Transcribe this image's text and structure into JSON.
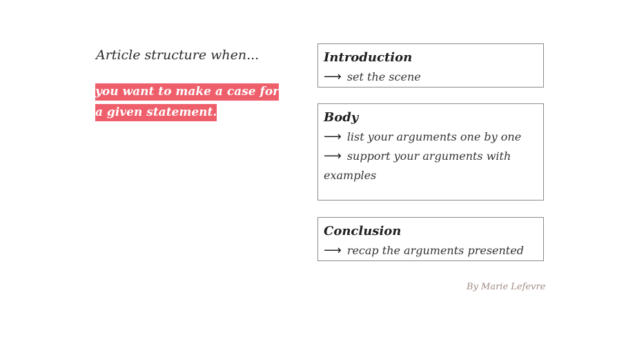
{
  "heading": "Article structure when...",
  "highlight_text": "you want to make a case for a given statement.",
  "colors": {
    "highlight": "#ee5f6b",
    "author": "#a08b84",
    "border": "#8a8a8a"
  },
  "arrow_glyph": "⟶",
  "cards": {
    "introduction": {
      "title": "Introduction",
      "lines": [
        "set the scene"
      ]
    },
    "body": {
      "title": "Body",
      "lines": [
        "list your arguments one by one",
        "support your arguments with examples"
      ]
    },
    "conclusion": {
      "title": "Conclusion",
      "lines": [
        "recap the arguments presented"
      ]
    }
  },
  "author": "By Marie Lefevre"
}
